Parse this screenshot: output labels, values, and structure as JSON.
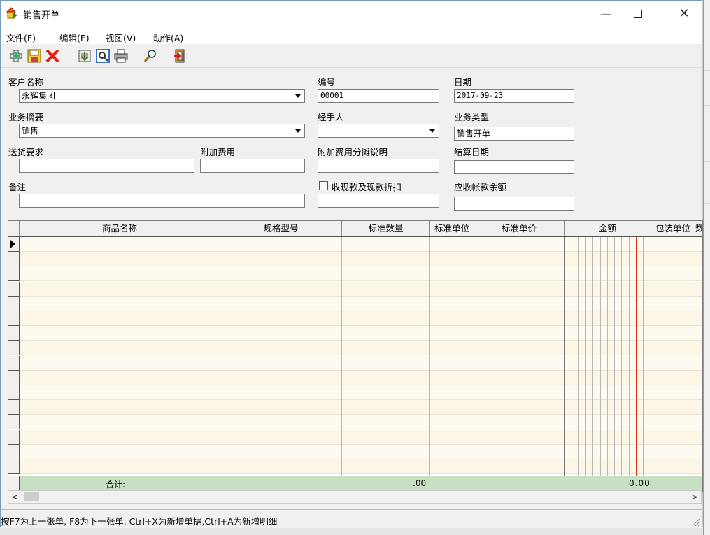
{
  "window": {
    "title": "销售开单"
  },
  "menu": [
    "文件(F)",
    "编辑(E)",
    "视图(V)",
    "动作(A)"
  ],
  "toolbar": [
    {
      "name": "add-icon"
    },
    {
      "name": "save-icon"
    },
    {
      "name": "delete-icon"
    },
    {
      "name": "import-icon"
    },
    {
      "name": "preview-icon"
    },
    {
      "name": "print-icon"
    },
    {
      "name": "find-icon"
    },
    {
      "name": "exit-icon"
    }
  ],
  "form": {
    "customer": {
      "label": "客户名称",
      "value": "永辉集团"
    },
    "number": {
      "label": "编号",
      "value": "00001"
    },
    "date": {
      "label": "日期",
      "value": "2017-09-23"
    },
    "summary": {
      "label": "业务摘要",
      "value": "销售"
    },
    "handler": {
      "label": "经手人",
      "value": ""
    },
    "biz_type": {
      "label": "业务类型",
      "value": "销售开单"
    },
    "delivery": {
      "label": "送货要求",
      "value": "—"
    },
    "extra_fee": {
      "label": "附加费用",
      "value": ""
    },
    "fee_note": {
      "label": "附加费用分摊说明",
      "value": "—"
    },
    "settle_date": {
      "label": "结算日期",
      "value": ""
    },
    "remark": {
      "label": "备注",
      "value": ""
    },
    "cash_discount": {
      "label": "收现款及现款折扣",
      "checked": false,
      "value": ""
    },
    "receivable": {
      "label": "应收帐款余额",
      "value": ""
    }
  },
  "grid": {
    "columns": [
      "商品名称",
      "规格型号",
      "标准数量",
      "标准单位",
      "标准单价",
      "金额",
      "包装单位",
      "数"
    ],
    "empty_rows": 16,
    "total_label": "合计:",
    "total_qty": ".00",
    "total_amount": "0.00"
  },
  "colors": {
    "row_bg": "#fcf6e6",
    "total_bg": "#c7dfc2",
    "amount_redline": "#e03020"
  },
  "status": "按F7为上一张单, F8为下一张单, Ctrl+X为新增单据,Ctrl+A为新增明细"
}
